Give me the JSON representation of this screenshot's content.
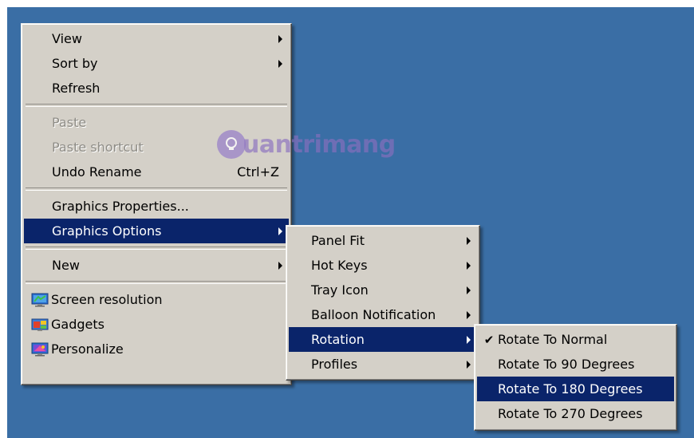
{
  "main_menu": {
    "items": [
      {
        "label": "View",
        "has_submenu": true
      },
      {
        "label": "Sort by",
        "has_submenu": true
      },
      {
        "label": "Refresh"
      },
      {
        "label": "Paste",
        "disabled": true
      },
      {
        "label": "Paste shortcut",
        "disabled": true
      },
      {
        "label": "Undo Rename",
        "shortcut": "Ctrl+Z"
      },
      {
        "label": "Graphics Properties..."
      },
      {
        "label": "Graphics Options",
        "has_submenu": true,
        "highlighted": true
      },
      {
        "label": "New",
        "has_submenu": true
      },
      {
        "label": "Screen resolution",
        "icon": "screen-resolution-icon"
      },
      {
        "label": "Gadgets",
        "icon": "gadgets-icon"
      },
      {
        "label": "Personalize",
        "icon": "personalize-icon"
      }
    ]
  },
  "graphics_submenu": {
    "items": [
      {
        "label": "Panel Fit",
        "has_submenu": true
      },
      {
        "label": "Hot Keys",
        "has_submenu": true
      },
      {
        "label": "Tray Icon",
        "has_submenu": true
      },
      {
        "label": "Balloon Notification",
        "has_submenu": true
      },
      {
        "label": "Rotation",
        "has_submenu": true,
        "highlighted": true
      },
      {
        "label": "Profiles",
        "has_submenu": true
      }
    ]
  },
  "rotation_submenu": {
    "items": [
      {
        "label": "Rotate To Normal",
        "checked": true
      },
      {
        "label": "Rotate To 90 Degrees"
      },
      {
        "label": "Rotate To 180 Degrees",
        "highlighted": true
      },
      {
        "label": "Rotate To 270 Degrees"
      }
    ]
  },
  "watermark": {
    "text": "uantrimang"
  },
  "colors": {
    "desktop": "#3a6ea5",
    "menu_bg": "#d4d0c8",
    "highlight": "#0a246a",
    "disabled_text": "#8e8c86"
  }
}
